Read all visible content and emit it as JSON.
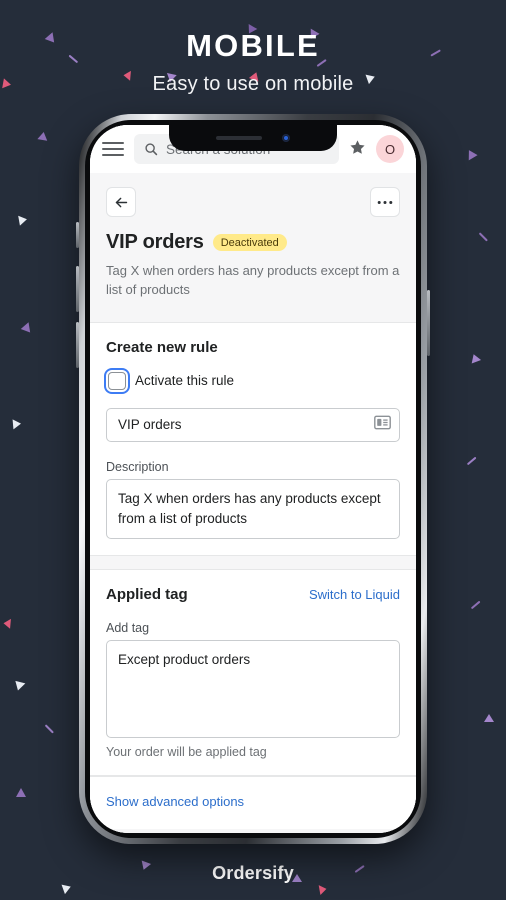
{
  "hero": {
    "title": "MOBILE",
    "subtitle": "Easy to use on mobile"
  },
  "footer": {
    "brand": "Ordersify"
  },
  "colors": {
    "background": "#252d3a",
    "accent_link": "#2c6ecb",
    "badge_bg": "#ffea8a",
    "avatar_bg": "#fbd5d8",
    "focus_ring": "#3d7cf4"
  },
  "app": {
    "topbar": {
      "menu_icon": "hamburger-icon",
      "search_icon": "search-icon",
      "search_placeholder": "Search a solution",
      "search_value": "",
      "star_icon": "star-icon",
      "avatar_initial": "O"
    },
    "nav": {
      "back_icon": "arrow-left-icon",
      "more_icon": "ellipsis-icon"
    },
    "page": {
      "title": "VIP orders",
      "status_badge": "Deactivated",
      "subtitle": "Tag X when orders has any products except from a list of products"
    },
    "rule_card": {
      "title": "Create new rule",
      "activate_label": "Activate this rule",
      "activate_checked": false,
      "name_value": "VIP orders",
      "name_icon": "card-list-icon",
      "description_label": "Description",
      "description_value": "Tag X when orders has any products except from a list of products"
    },
    "tag_card": {
      "title": "Applied tag",
      "switch_link": "Switch to Liquid",
      "add_tag_label": "Add tag",
      "add_tag_value": "Except product orders",
      "helper_text": "Your order will be applied tag"
    },
    "advanced": {
      "link": "Show advanced options"
    }
  }
}
